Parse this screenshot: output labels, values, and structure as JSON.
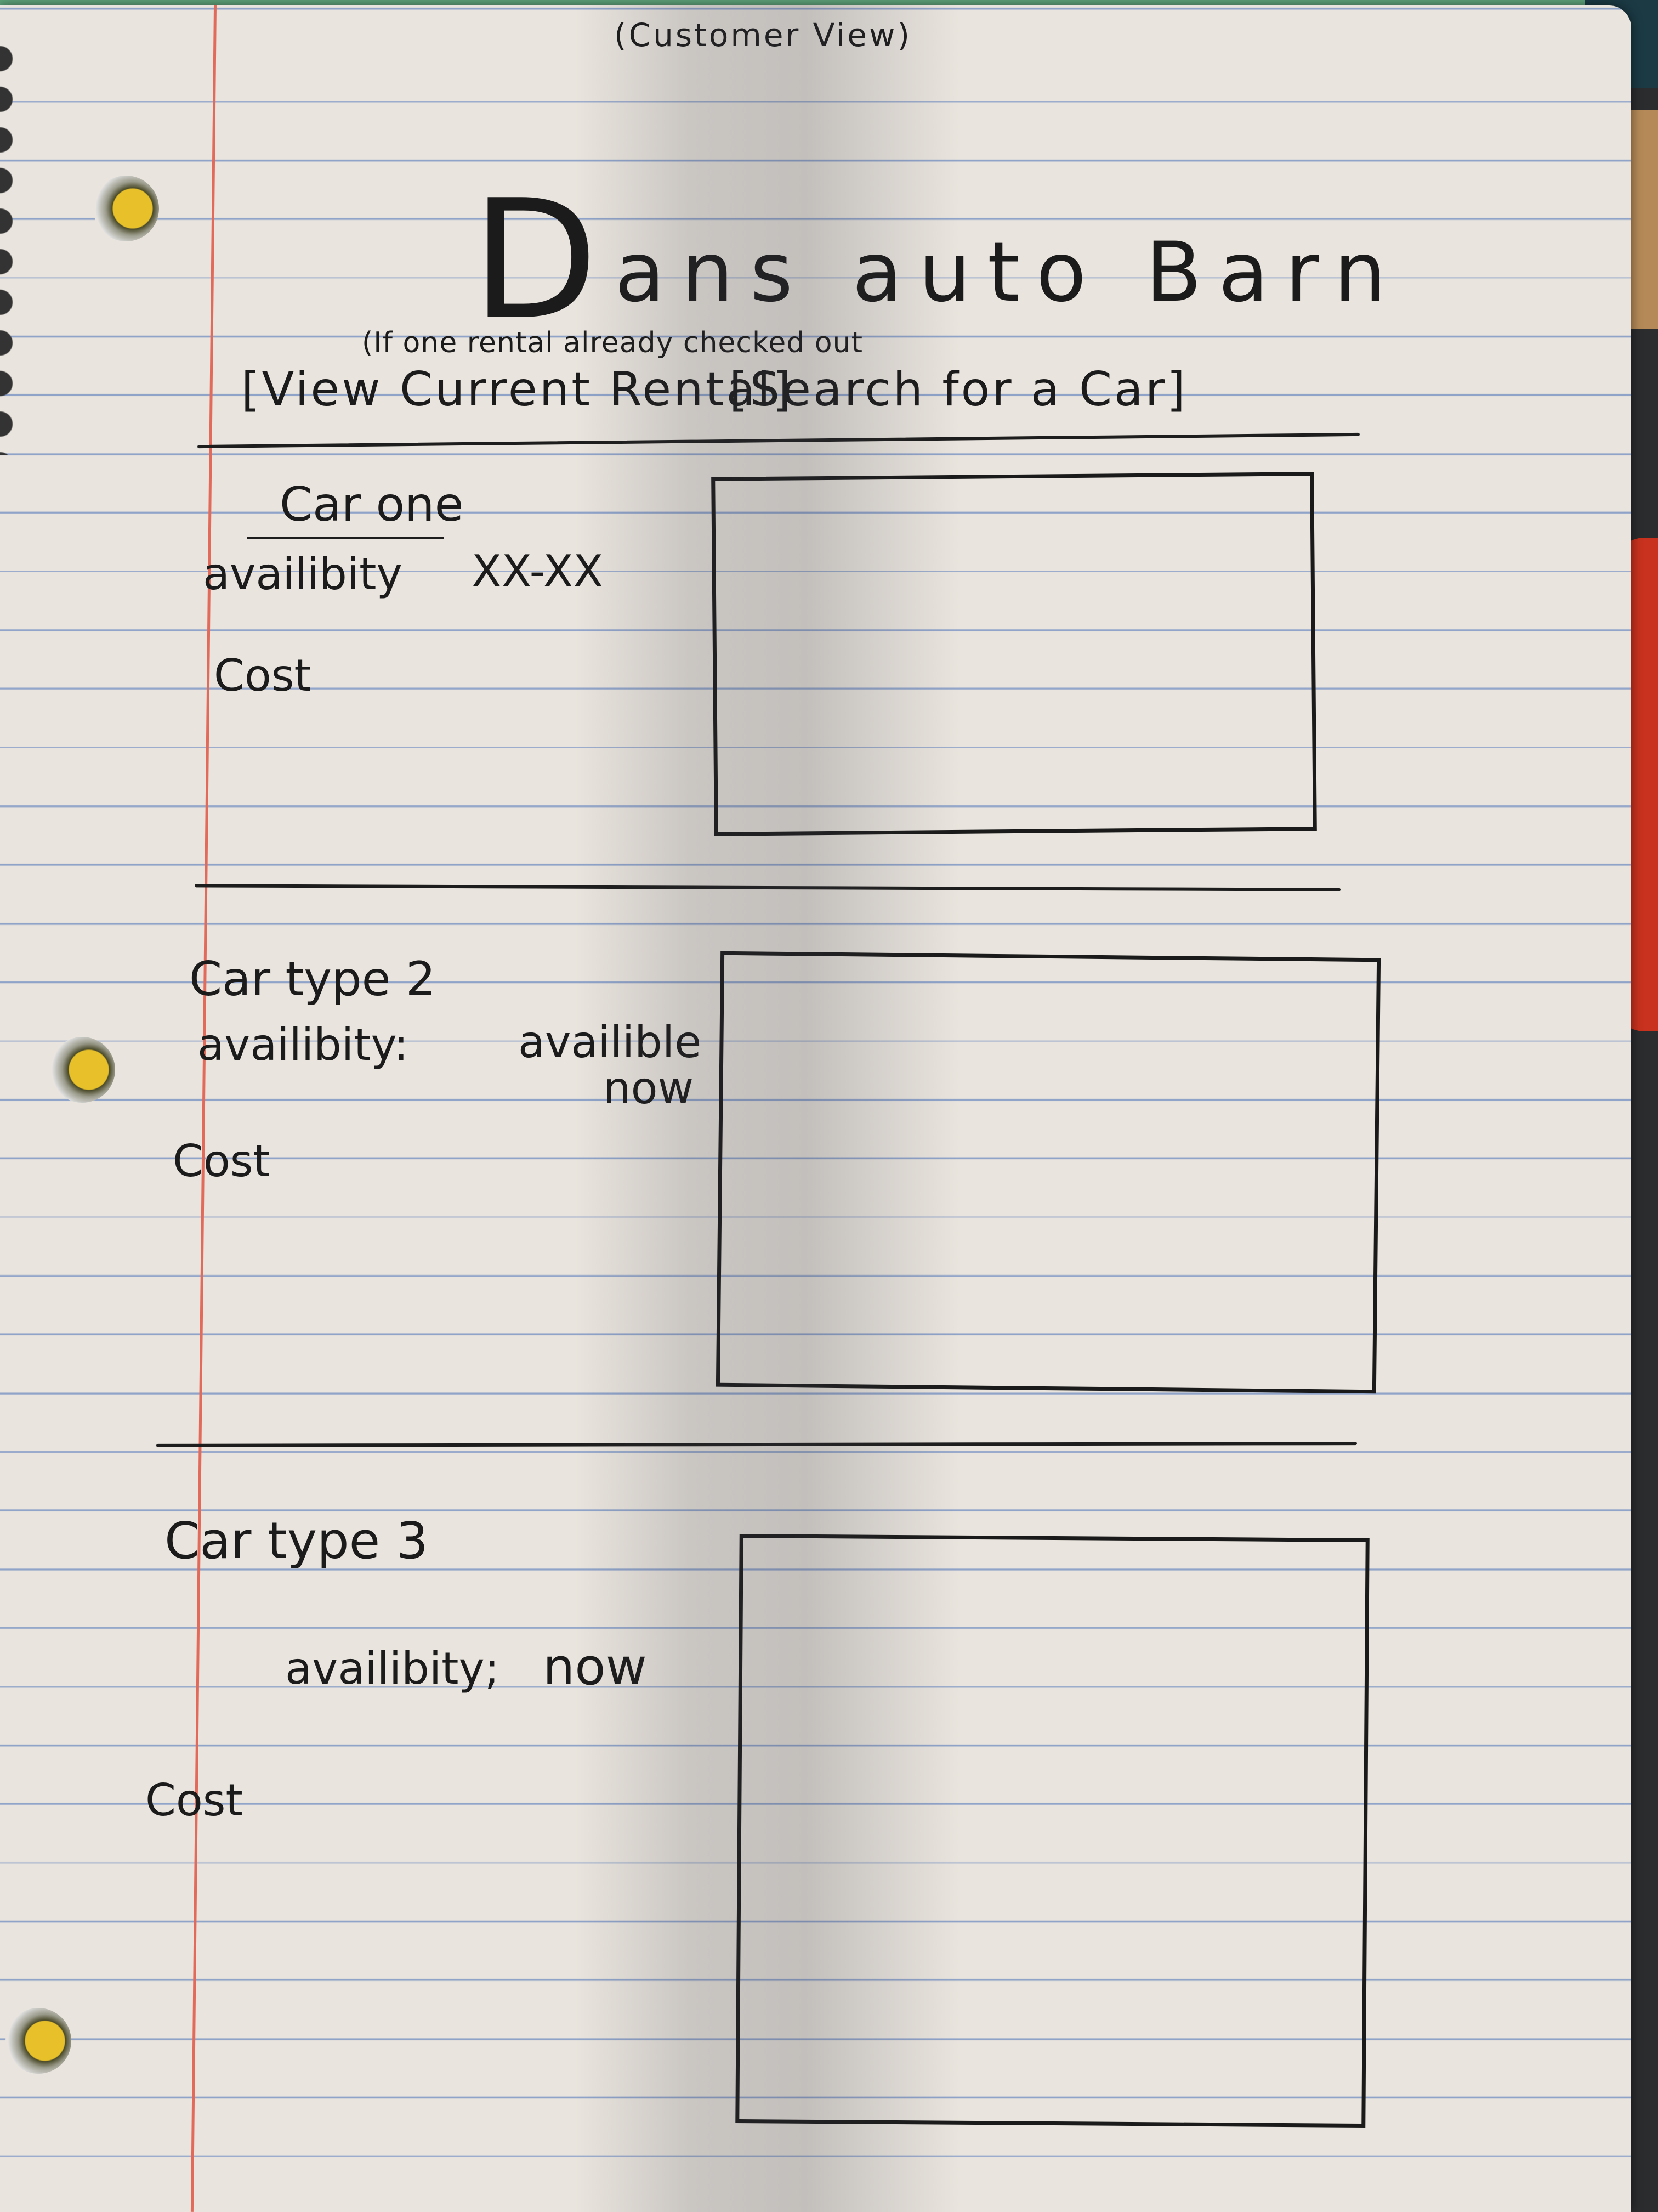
{
  "page_label": "(Customer View)",
  "title": {
    "initial": "D",
    "rest": "ans auto Barn"
  },
  "note": "(If one rental already checked out",
  "nav": {
    "view_rental": "[View Current Rental]",
    "search": "[Search for a Car]"
  },
  "cars": [
    {
      "name": "Car one",
      "availability_label": "availibity",
      "availability_value": "XX-XX",
      "cost_label": "Cost"
    },
    {
      "name": "Car type 2",
      "availability_label": "availibity:",
      "availability_value": "availible now",
      "cost_label": "Cost"
    },
    {
      "name": "Car type 3",
      "availability_label": "availibity;",
      "availability_value": "now",
      "cost_label": "Cost"
    }
  ]
}
